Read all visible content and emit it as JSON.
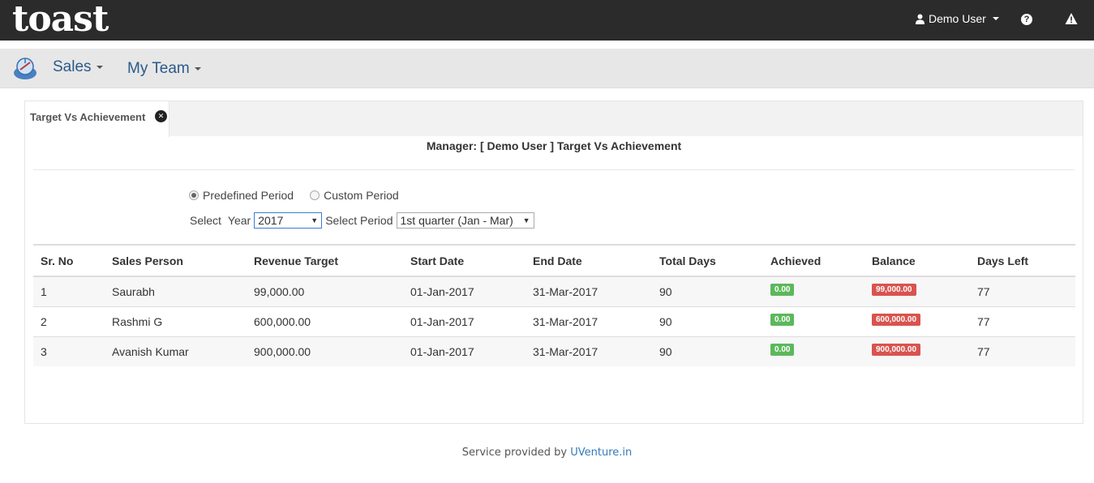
{
  "app": {
    "logo_text": "toast"
  },
  "topbar": {
    "user_label": "Demo User"
  },
  "nav": {
    "items": [
      {
        "label": "Sales"
      },
      {
        "label": "My Team"
      }
    ]
  },
  "tab": {
    "label": "Target Vs Achievement"
  },
  "report": {
    "title": "Manager: [ Demo User ] Target Vs Achievement"
  },
  "period": {
    "options": [
      {
        "label": "Predefined Period",
        "checked": true
      },
      {
        "label": "Custom Period",
        "checked": false
      }
    ],
    "select_label": "Select",
    "year_label": "Year",
    "year_value": "2017",
    "period_label": "Select Period",
    "period_value": "1st quarter (Jan - Mar)"
  },
  "table": {
    "columns": [
      "Sr. No",
      "Sales Person",
      "Revenue Target",
      "Start Date",
      "End Date",
      "Total Days",
      "Achieved",
      "Balance",
      "Days Left"
    ],
    "rows": [
      {
        "sr": "1",
        "person": "Saurabh",
        "target": "99,000.00",
        "start": "01-Jan-2017",
        "end": "31-Mar-2017",
        "total_days": "90",
        "achieved": "0.00",
        "balance": "99,000.00",
        "days_left": "77"
      },
      {
        "sr": "2",
        "person": "Rashmi G",
        "target": "600,000.00",
        "start": "01-Jan-2017",
        "end": "31-Mar-2017",
        "total_days": "90",
        "achieved": "0.00",
        "balance": "600,000.00",
        "days_left": "77"
      },
      {
        "sr": "3",
        "person": "Avanish Kumar",
        "target": "900,000.00",
        "start": "01-Jan-2017",
        "end": "31-Mar-2017",
        "total_days": "90",
        "achieved": "0.00",
        "balance": "900,000.00",
        "days_left": "77"
      }
    ]
  },
  "footer": {
    "text": "Service provided by",
    "link_text": "UVenture.in"
  },
  "colors": {
    "topbar": "#2b2b2b",
    "navbar": "#e7e7e7",
    "achieved_badge": "#5cb85c",
    "balance_badge": "#d9534f",
    "link": "#337ab7"
  },
  "icons": {
    "user": "user-icon",
    "help": "help-icon",
    "warning": "warning-icon",
    "close": "close-icon",
    "app": "app-logo-icon"
  }
}
